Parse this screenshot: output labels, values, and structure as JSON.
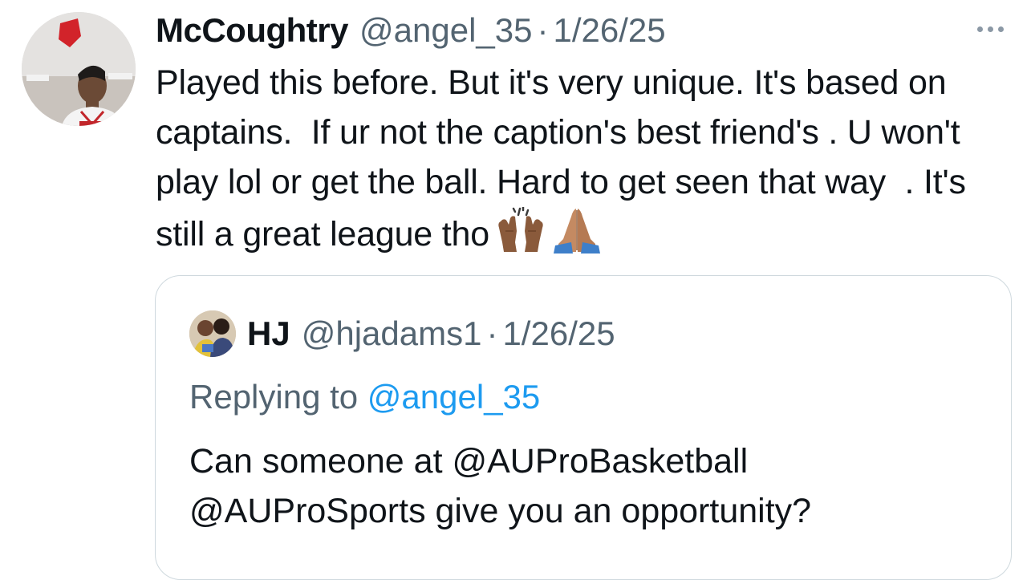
{
  "tweet": {
    "display_name": "McCoughtry",
    "handle": "@angel_35",
    "separator": "·",
    "date": "1/26/25",
    "text": "Played this before. But it's very unique. It's based on captains.  If ur not the caption's best friend's . U won't play lol or get the ball. Hard to get seen that way  . It's still a great league tho",
    "emojis": [
      "raising-hands-emoji",
      "folded-hands-emoji"
    ]
  },
  "quote": {
    "display_name": "HJ",
    "handle": "@hjadams1",
    "separator": "·",
    "date": "1/26/25",
    "replying_prefix": "Replying to",
    "replying_to": "@angel_35",
    "text": "Can someone at @AUProBasketball\n@AUProSports give you an opportunity?"
  },
  "icons": {
    "more": "more-horizontal-icon"
  },
  "colors": {
    "text_primary": "#0f1419",
    "text_secondary": "#536471",
    "link": "#1d9bf0",
    "border": "#cfd9de"
  }
}
